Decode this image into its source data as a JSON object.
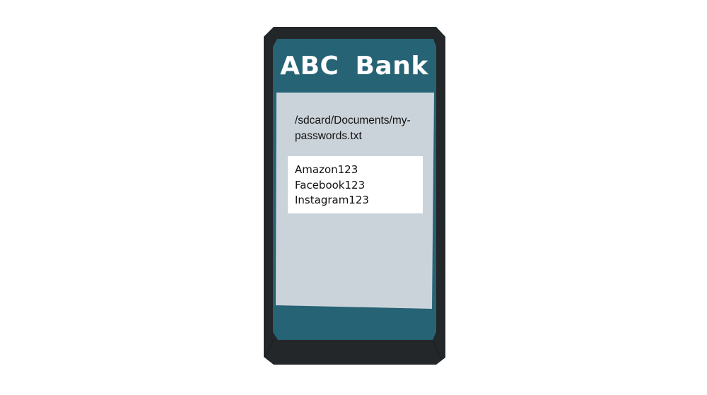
{
  "app": {
    "title": "ABC Bank"
  },
  "file": {
    "path": "/sdcard/Documents/my-passwords.txt",
    "lines": [
      "Amazon123",
      "Facebook123",
      "Instagram123"
    ]
  },
  "colors": {
    "phone_frame": "#23272a",
    "header_teal": "#266374",
    "screen_gray": "#cbd3da",
    "content_bg": "#ffffff"
  }
}
